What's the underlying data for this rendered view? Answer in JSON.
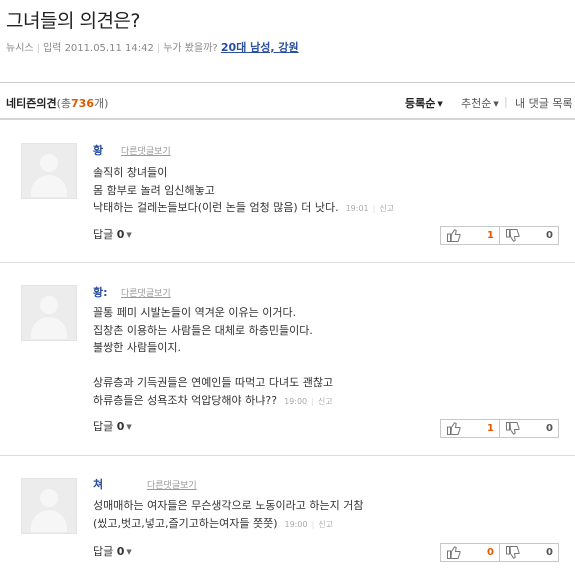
{
  "article": {
    "title": "그녀들의 의견은?",
    "source": "뉴시스",
    "date_label": "입력 2011.05.11 14:42",
    "who_viewed_label": "누가 봤을까?",
    "who_viewed_value": "20대 남성, 강원"
  },
  "comments_bar": {
    "title": "네티즌의견",
    "count_prefix": "(총",
    "count": "736",
    "count_suffix": "개)",
    "sort_options": [
      "등록순",
      "추천순",
      "내 댓글 목록"
    ]
  },
  "comments": [
    {
      "author": "황",
      "reply_link": "다른댓글보기",
      "lines": [
        "솔직히 창녀들이",
        "몸 함부로 놀려 임신해놓고",
        "낙태하는 걸레논들보다(이런 논들 엄청 많음) 더 낫다."
      ],
      "time": "19:01",
      "report": "신고",
      "replies_label": "답글",
      "replies_count": "0",
      "likes": "1",
      "dislikes": "0"
    },
    {
      "author": "황:",
      "reply_link": "다른댓글보기",
      "lines": [
        "꼴통 페미 시발논들이 역겨운 이유는 이거다.",
        "집창촌 이용하는 사람들은 대체로 하층민들이다.",
        "불쌍한 사람들이지.",
        "",
        "상류층과 기득권들은 연예인들 따먹고 다녀도 괜찮고",
        "하류층들은 성욕조차 억압당해야 하냐??"
      ],
      "time": "19:00",
      "report": "신고",
      "replies_label": "답글",
      "replies_count": "0",
      "likes": "1",
      "dislikes": "0"
    },
    {
      "author": "쳐",
      "reply_link": "다른댓글보기",
      "lines": [
        "성매매하는 여자들은 무슨생각으로 노동이라고 하는지 거참",
        "(씼고,벗고,넣고,즐기고하는여자들 쯧쯧)"
      ],
      "time": "19:00",
      "report": "신고",
      "replies_label": "답글",
      "replies_count": "0",
      "likes": "0",
      "dislikes": "0"
    }
  ],
  "colors": {
    "link_blue": "#2a4f9e",
    "accent_orange": "#e05a00"
  },
  "icons": {
    "like": "thumbs-up-icon",
    "dislike": "thumbs-down-icon",
    "caret": "caret-down-icon"
  }
}
